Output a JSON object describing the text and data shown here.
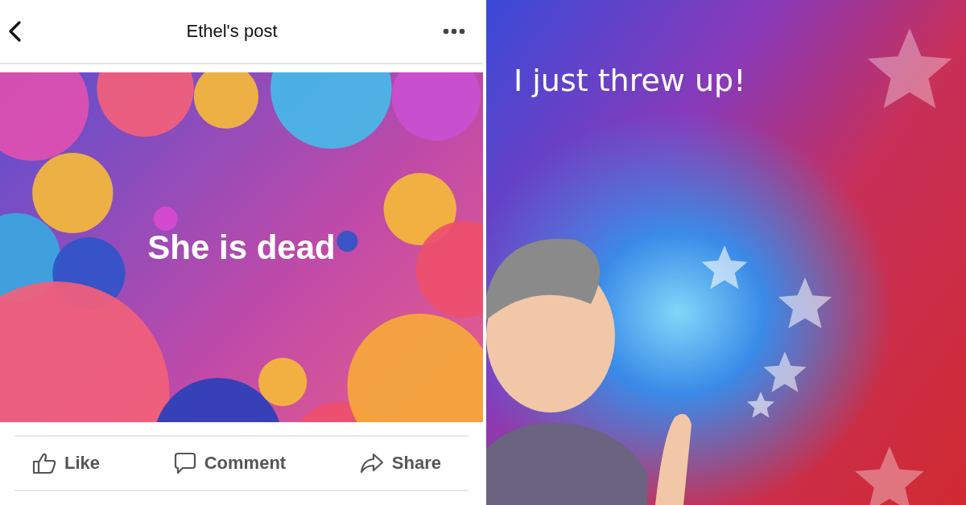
{
  "post_screen": {
    "title": "Ethel's post",
    "post": {
      "text": "She is dead"
    },
    "actions": [
      {
        "kind": "like",
        "label": "Like"
      },
      {
        "kind": "comment",
        "label": "Comment"
      },
      {
        "kind": "share",
        "label": "Share"
      }
    ]
  },
  "story_screen": {
    "caption": "I just threw up!"
  }
}
